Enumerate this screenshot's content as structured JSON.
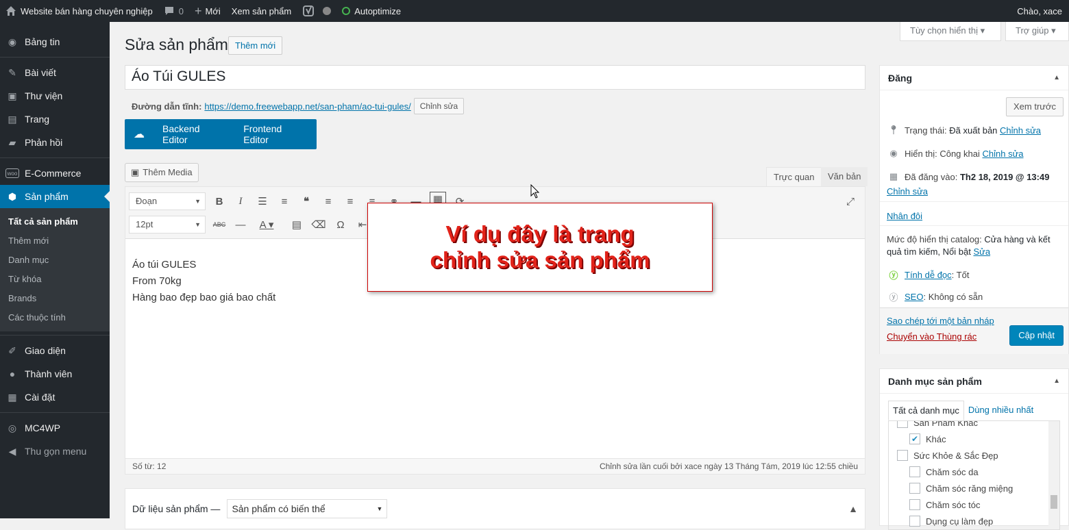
{
  "adminbar": {
    "site": "Website bán hàng chuyên nghiệp",
    "comments": "0",
    "new": "Mới",
    "view": "Xem sản phẩm",
    "autoptimize": "Autoptimize",
    "greeting": "Chào, xace"
  },
  "sidebar": {
    "items": [
      {
        "label": "Bảng tin",
        "icon": "dashboard-icon"
      },
      {
        "label": "Bài viết",
        "icon": "pin-icon"
      },
      {
        "label": "Thư viện",
        "icon": "media-icon"
      },
      {
        "label": "Trang",
        "icon": "page-icon"
      },
      {
        "label": "Phản hồi",
        "icon": "comment-icon"
      },
      {
        "label": "E-Commerce",
        "icon": "woo-icon"
      },
      {
        "label": "Sản phẩm",
        "icon": "box-icon"
      },
      {
        "label": "Giao diện",
        "icon": "brush-icon"
      },
      {
        "label": "Thành viên",
        "icon": "user-icon"
      },
      {
        "label": "Cài đặt",
        "icon": "settings-icon"
      },
      {
        "label": "MC4WP",
        "icon": "mc4wp-icon"
      },
      {
        "label": "Thu gọn menu",
        "icon": "collapse-icon"
      }
    ],
    "sub": [
      "Tất cả sản phẩm",
      "Thêm mới",
      "Danh mục",
      "Từ khóa",
      "Brands",
      "Các thuộc tính"
    ]
  },
  "screen": {
    "options": "Tùy chọn hiển thị",
    "help": "Trợ giúp"
  },
  "page": {
    "title": "Sửa sản phẩm",
    "add_new": "Thêm mới",
    "post_title": "Áo Túi GULES",
    "permalink_label": "Đường dẫn tĩnh:",
    "permalink": "https://demo.freewebapp.net/san-pham/ao-tui-gules/",
    "edit": "Chỉnh sửa"
  },
  "vc": {
    "backend": "Backend Editor",
    "frontend": "Frontend Editor"
  },
  "editor": {
    "add_media": "Thêm Media",
    "tab_visual": "Trực quan",
    "tab_text": "Văn bản",
    "format": "Đoạn",
    "size": "12pt",
    "lines": [
      "Áo túi GULES",
      "From 70kg",
      "Hàng bao đẹp bao giá bao chất"
    ],
    "word_count": "Số từ: 12",
    "last_edit": "Chỉnh sửa lần cuối bởi xace ngày 13 Tháng Tám, 2019 lúc 12:55 chiều"
  },
  "overlay": {
    "line1": "Ví dụ đây là trang",
    "line2": "chỉnh sửa sản phẩm"
  },
  "product_data": {
    "label": "Dữ liệu sản phẩm —",
    "type": "Sản phẩm có biến thể"
  },
  "publish": {
    "title": "Đăng",
    "preview": "Xem trước",
    "status_label": "Trạng thái:",
    "status": "Đã xuất bản",
    "edit": "Chỉnh sửa",
    "visibility_label": "Hiển thị:",
    "visibility": "Công khai",
    "date_label": "Đã đăng vào:",
    "date": "Th2 18, 2019 @ 13:49",
    "duplicate": "Nhân đôi",
    "catalog_label": "Mức độ hiển thị catalog:",
    "catalog": "Cửa hàng và kết quả tìm kiếm, Nổi bật",
    "catalog_edit": "Sửa",
    "readability_link": "Tính dễ đọc",
    "readability": ": Tốt",
    "seo_link": "SEO",
    "seo": ": Không có sẵn",
    "copy_draft": "Sao chép tới một bản nháp",
    "trash": "Chuyển vào Thùng rác",
    "update": "Cập nhật"
  },
  "categories": {
    "title": "Danh mục sản phẩm",
    "tab_all": "Tất cả danh mục",
    "tab_popular": "Dùng nhiều nhất",
    "items": [
      {
        "label": "Sản Phẩm Khác",
        "checked": false,
        "indent": 0
      },
      {
        "label": "Khác",
        "checked": true,
        "indent": 1
      },
      {
        "label": "Sức Khỏe & Sắc Đẹp",
        "checked": false,
        "indent": 0
      },
      {
        "label": "Chăm sóc da",
        "checked": false,
        "indent": 1
      },
      {
        "label": "Chăm sóc răng miệng",
        "checked": false,
        "indent": 1
      },
      {
        "label": "Chăm sóc tóc",
        "checked": false,
        "indent": 1
      },
      {
        "label": "Dụng cụ làm đẹp",
        "checked": false,
        "indent": 1
      }
    ]
  },
  "colors": {
    "accent": "#0073aa",
    "sidebar": "#23282d",
    "overlay_text": "#e2231a"
  }
}
